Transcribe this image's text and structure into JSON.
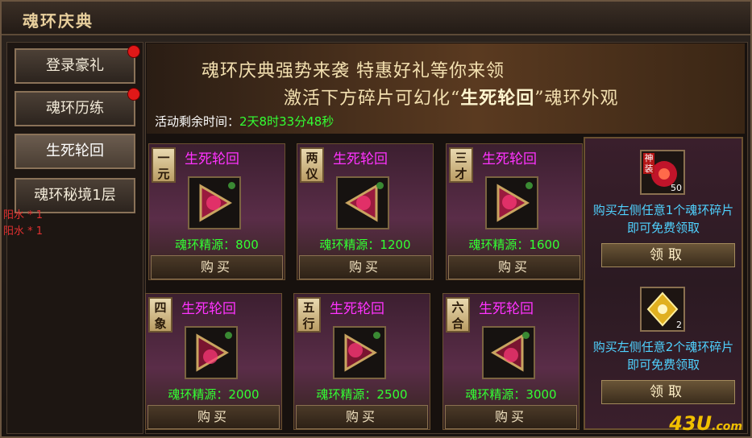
{
  "window": {
    "title": "魂环庆典"
  },
  "nav": {
    "items": [
      {
        "label": "登录豪礼",
        "dot": true
      },
      {
        "label": "魂环历练",
        "dot": true
      },
      {
        "label": "生死轮回",
        "active": true
      },
      {
        "label": "魂环秘境1层"
      }
    ],
    "side_lines": [
      "阳水 * 1",
      "阳水 * 1"
    ]
  },
  "banner": {
    "line1": "魂环庆典强势来袭  特惠好礼等你来领",
    "line2_prefix": "激活下方碎片可幻化“",
    "line2_highlight": "生死轮回",
    "line2_suffix": "”魂环外观"
  },
  "timer": {
    "label": "活动剩余时间：",
    "value": "2天8时33分48秒"
  },
  "cards": [
    {
      "badge": "一元",
      "name": "生死轮回",
      "cost": "魂环精源：800",
      "buy": "购买"
    },
    {
      "badge": "两仪",
      "name": "生死轮回",
      "cost": "魂环精源：1200",
      "buy": "购买"
    },
    {
      "badge": "三才",
      "name": "生死轮回",
      "cost": "魂环精源：1600",
      "buy": "购买"
    },
    {
      "badge": "四象",
      "name": "生死轮回",
      "cost": "魂环精源：2000",
      "buy": "购买"
    },
    {
      "badge": "五行",
      "name": "生死轮回",
      "cost": "魂环精源：2500",
      "buy": "购买"
    },
    {
      "badge": "六合",
      "name": "生死轮回",
      "cost": "魂环精源：3000",
      "buy": "购买"
    }
  ],
  "rewards": [
    {
      "tag": "神装",
      "count": "50",
      "text": "购买左侧任意1个魂环碎片即可免费领取",
      "claim": "领取"
    },
    {
      "count": "2",
      "text": "购买左侧任意2个魂环碎片即可免费领取",
      "claim": "领取"
    }
  ],
  "watermark": {
    "main": "43U",
    "sub": ".com"
  },
  "colors": {
    "accent_green": "#33ff33",
    "accent_magenta": "#ff33ff",
    "accent_cyan": "#4fd2ff",
    "alert_red": "#e01818"
  }
}
